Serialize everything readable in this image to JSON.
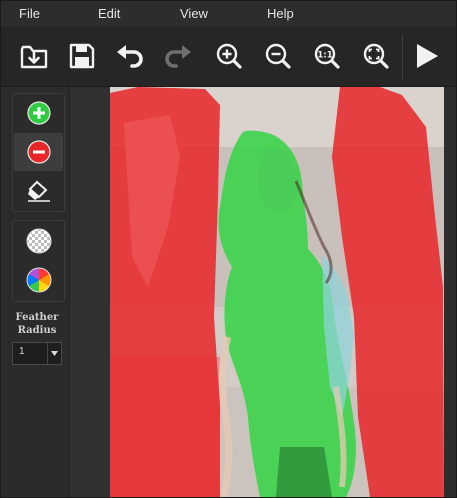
{
  "menu": {
    "file": "File",
    "edit": "Edit",
    "view": "View",
    "help": "Help"
  },
  "toolbar": [
    {
      "name": "open-folder-icon"
    },
    {
      "name": "save-icon"
    },
    {
      "name": "undo-icon"
    },
    {
      "name": "redo-icon"
    },
    {
      "name": "zoom-in-icon"
    },
    {
      "name": "zoom-out-icon"
    },
    {
      "name": "actual-size-icon",
      "label": "1:1"
    },
    {
      "name": "fit-to-window-icon"
    },
    {
      "name": "play-icon"
    }
  ],
  "sidebar": {
    "feather_line1": "Feather",
    "feather_line2": "Radius",
    "feather_value": "1"
  },
  "colors": {
    "keep_green": "#2ecc40",
    "remove_red": "#e8262a",
    "toolbar_bg": "#262626",
    "menu_text": "#e4e4e4"
  }
}
